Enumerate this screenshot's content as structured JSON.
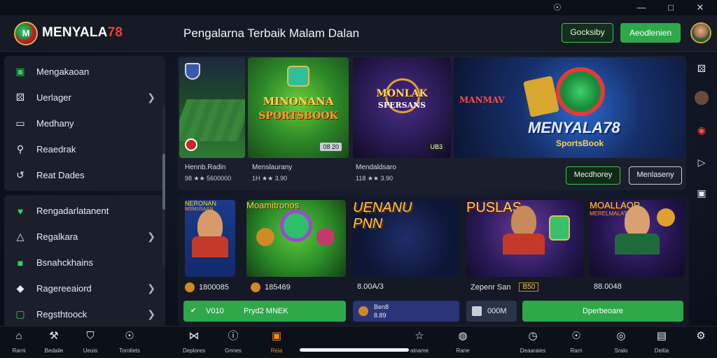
{
  "header": {
    "brand_main": "MENYALA",
    "brand_num": "78",
    "tagline": "Pengalarna Terbaik Malam Dalan",
    "btn_outline": "Gocksiby",
    "btn_solid": "Aeodlenien"
  },
  "sidebar": {
    "group1": [
      {
        "label": "Mengakaoan",
        "icon": "calendar-icon",
        "chevron": false
      },
      {
        "label": "Uerlager",
        "icon": "dice-icon",
        "chevron": true
      },
      {
        "label": "Medhany",
        "icon": "monitor-icon",
        "chevron": false
      },
      {
        "label": "Reaedrak",
        "icon": "search-icon",
        "chevron": false
      },
      {
        "label": "Reat Dades",
        "icon": "history-icon",
        "chevron": false
      }
    ],
    "group2": [
      {
        "label": "Rengadarlatanent",
        "icon": "shield-icon",
        "chevron": false
      },
      {
        "label": "Regalkara",
        "icon": "users-icon",
        "chevron": true
      },
      {
        "label": "Bsnahckhains",
        "icon": "wallet-icon",
        "chevron": false
      },
      {
        "label": "Ragereeaiord",
        "icon": "chat-icon",
        "chevron": true
      },
      {
        "label": "Regsthtoock",
        "icon": "box-icon",
        "chevron": true
      }
    ]
  },
  "banner": {
    "tile1_cap": "Hennb.Radin",
    "tile1_sub": "98 ★★ 5600000",
    "tile2_art": "MINONANA",
    "tile2_art2": "SPORTSBOOK",
    "tile2_badge": "08 20",
    "tile2_cap": "Menslaurany",
    "tile2_sub": "1H ★★ 3.90",
    "tile3_art": "MONLAK",
    "tile3_art2": "SPERSANS",
    "tile3_badge": "UB3",
    "tile3_cap": "Mendaldsaro",
    "tile3_sub": "118 ★★ 3.90",
    "hero_small": "MANMAV",
    "hero_title": "MENYALA78",
    "hero_sub": "SportsBook",
    "hero_btn1": "Mecdhorey",
    "hero_btn2": "Menlaseny"
  },
  "grid": {
    "t1_art": "NERONAN",
    "t1_art2": "MSMUSAAN",
    "t1_val": "1800085",
    "t2_art": "Moamitronos",
    "t2_val": "185469",
    "t3_art": "UENANU",
    "t3_art2": "PNN",
    "t3_val": "8.00A/3",
    "t4_art": "PUSLAS",
    "t4_cap": "Zepenr San",
    "t4_badge": "B50",
    "t5_art": "MOALLAOR",
    "t5_art2": "MERELMALAT",
    "t5_val": "88.0048",
    "btn1_left": "V010",
    "btn1_right": "Pryd2 MNEK",
    "btn2_top": "Ben8",
    "btn2_bot": "8.89",
    "btn3": "000M",
    "btn4": "Dperbeoare"
  },
  "bottom_nav": [
    {
      "label": "Rarni",
      "icon": "home-icon"
    },
    {
      "label": "Bedaile",
      "icon": "run-icon"
    },
    {
      "label": "Ueois",
      "icon": "shield-icon"
    },
    {
      "label": "Toroliets",
      "icon": "soccer-icon"
    },
    {
      "label": "Deplores",
      "icon": "bowtie-icon"
    },
    {
      "label": "Gnnes",
      "icon": "info-icon"
    },
    {
      "label": "Reia",
      "icon": "square-icon",
      "active": true
    },
    {
      "label": "ainame",
      "icon": "star-icon"
    },
    {
      "label": "Rane",
      "icon": "ball-icon"
    },
    {
      "label": "Deaaraies",
      "icon": "clock-icon"
    },
    {
      "label": "Rarn",
      "icon": "soccer-ball-icon"
    },
    {
      "label": "Sralo",
      "icon": "compass-icon"
    },
    {
      "label": "Deltia",
      "icon": "window-icon"
    }
  ],
  "colors": {
    "accent_green": "#2fa84a",
    "accent_orange": "#f08a24",
    "brand_red": "#ff3b3b"
  }
}
